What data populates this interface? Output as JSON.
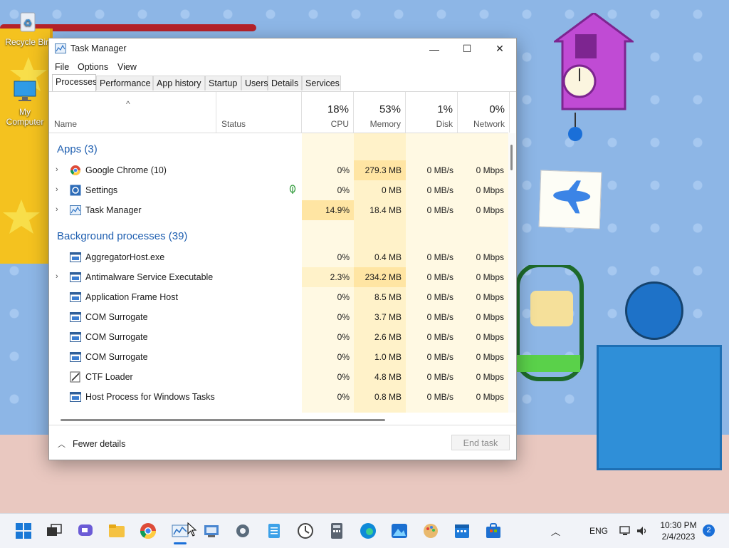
{
  "desktop": {
    "icons": [
      {
        "label": "Recycle Bin"
      },
      {
        "label": "My Computer"
      }
    ]
  },
  "window": {
    "title": "Task Manager",
    "controls": {
      "minimize": "—",
      "maximize": "☐",
      "close": "✕"
    }
  },
  "menu": [
    "File",
    "Options",
    "View"
  ],
  "tabs": [
    "Processes",
    "Performance",
    "App history",
    "Startup",
    "Users",
    "Details",
    "Services"
  ],
  "active_tab": "Processes",
  "columns": {
    "name": "Name",
    "status": "Status",
    "cpu": {
      "pct": "18%",
      "label": "CPU"
    },
    "memory": {
      "pct": "53%",
      "label": "Memory"
    },
    "disk": {
      "pct": "1%",
      "label": "Disk"
    },
    "network": {
      "pct": "0%",
      "label": "Network"
    }
  },
  "groups": {
    "apps": "Apps (3)",
    "background": "Background processes (39)"
  },
  "apps": [
    {
      "name": "Google Chrome (10)",
      "cpu": "0%",
      "memory": "279.3 MB",
      "disk": "0 MB/s",
      "network": "0 Mbps",
      "icon": "chrome-icon",
      "expand": true
    },
    {
      "name": "Settings",
      "cpu": "0%",
      "memory": "0 MB",
      "disk": "0 MB/s",
      "network": "0 Mbps",
      "icon": "settings-icon",
      "expand": true,
      "status_icon": "leaf-icon"
    },
    {
      "name": "Task Manager",
      "cpu": "14.9%",
      "memory": "18.4 MB",
      "disk": "0 MB/s",
      "network": "0 Mbps",
      "icon": "task-manager-icon",
      "expand": true
    }
  ],
  "background": [
    {
      "name": "AggregatorHost.exe",
      "cpu": "0%",
      "memory": "0.4 MB",
      "disk": "0 MB/s",
      "network": "0 Mbps",
      "expand": false
    },
    {
      "name": "Antimalware Service Executable",
      "cpu": "2.3%",
      "memory": "234.2 MB",
      "disk": "0 MB/s",
      "network": "0 Mbps",
      "expand": true
    },
    {
      "name": "Application Frame Host",
      "cpu": "0%",
      "memory": "8.5 MB",
      "disk": "0 MB/s",
      "network": "0 Mbps",
      "expand": false
    },
    {
      "name": "COM Surrogate",
      "cpu": "0%",
      "memory": "3.7 MB",
      "disk": "0 MB/s",
      "network": "0 Mbps",
      "expand": false
    },
    {
      "name": "COM Surrogate",
      "cpu": "0%",
      "memory": "2.6 MB",
      "disk": "0 MB/s",
      "network": "0 Mbps",
      "expand": false
    },
    {
      "name": "COM Surrogate",
      "cpu": "0%",
      "memory": "1.0 MB",
      "disk": "0 MB/s",
      "network": "0 Mbps",
      "expand": false
    },
    {
      "name": "CTF Loader",
      "cpu": "0%",
      "memory": "4.8 MB",
      "disk": "0 MB/s",
      "network": "0 Mbps",
      "expand": false
    },
    {
      "name": "Host Process for Windows Tasks",
      "cpu": "0%",
      "memory": "0.8 MB",
      "disk": "0 MB/s",
      "network": "0 Mbps",
      "expand": false
    }
  ],
  "footer": {
    "fewer_details": "Fewer details",
    "end_task": "End task"
  },
  "taskbar": {
    "apps": [
      "start-icon",
      "task-view-icon",
      "chat-icon",
      "file-explorer-icon",
      "chrome-icon",
      "task-manager-icon",
      "control-panel-icon",
      "settings-icon",
      "notepad-icon",
      "clock-icon",
      "calculator-icon",
      "edge-icon",
      "photos-icon",
      "paint-icon",
      "calendar-icon",
      "store-icon"
    ],
    "language": "ENG",
    "time": "10:30 PM",
    "date": "2/4/2023",
    "notifications": "2"
  },
  "colors": {
    "heat_light": "#fff9e3",
    "heat_mid": "#fff2c9",
    "heat_strong": "#ffe5a3",
    "accent": "#1a6fd8",
    "group_text": "#1f5fb0"
  }
}
